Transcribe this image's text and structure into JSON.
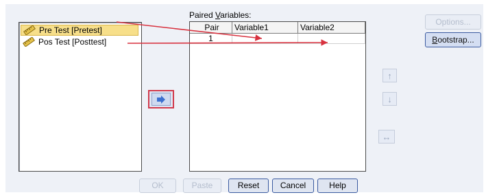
{
  "source_list": {
    "items": [
      {
        "label": "Pre Test [Pretest]",
        "selected": true
      },
      {
        "label": "Pos Test [Posttest]",
        "selected": false
      }
    ]
  },
  "paired_variables": {
    "label_prefix": "Paired ",
    "label_mnemonic": "V",
    "label_rest": "ariables:",
    "columns": [
      "Pair",
      "Variable1",
      "Variable2"
    ],
    "rows": [
      {
        "pair": "1",
        "variable1": "",
        "variable2": ""
      }
    ]
  },
  "buttons": {
    "options": "Options...",
    "bootstrap": "Bootstrap...",
    "ok": "OK",
    "paste": "Paste",
    "reset": "Reset",
    "cancel": "Cancel",
    "help": "Help"
  },
  "icons": {
    "move": "right-arrow-icon",
    "up": "up-arrow-icon",
    "down": "down-arrow-icon",
    "swap": "swap-arrows-icon",
    "variable": "ruler-scale-icon"
  },
  "colors": {
    "annotation_arrow": "#d8323f",
    "selected_item": "#f7df8a",
    "move_button_border": "#d23a4b"
  }
}
